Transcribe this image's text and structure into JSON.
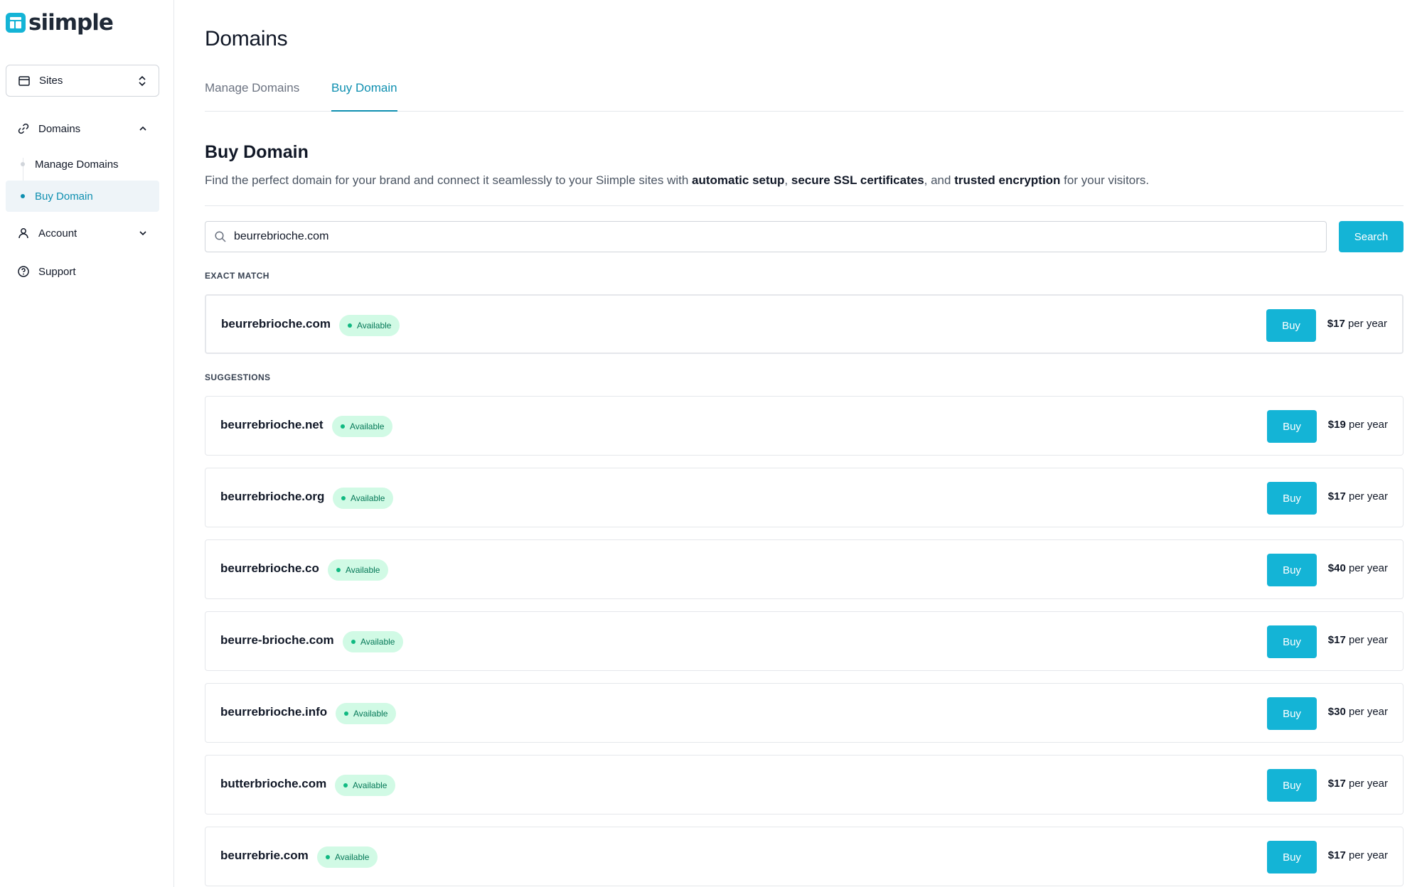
{
  "brand": {
    "name": "siimple",
    "color": "#14b4d6"
  },
  "sidebar": {
    "site_select": {
      "label": "Sites"
    },
    "items": [
      {
        "label": "Domains",
        "icon": "link-icon",
        "expanded": true
      },
      {
        "label": "Account",
        "icon": "user-icon",
        "expanded": false
      },
      {
        "label": "Support",
        "icon": "help-circle-icon"
      }
    ],
    "domains_sub": [
      {
        "label": "Manage Domains",
        "active": false
      },
      {
        "label": "Buy Domain",
        "active": true
      }
    ]
  },
  "page": {
    "title": "Domains",
    "tabs": [
      {
        "label": "Manage Domains",
        "active": false
      },
      {
        "label": "Buy Domain",
        "active": true
      }
    ]
  },
  "buy": {
    "title": "Buy Domain",
    "desc_1": "Find the perfect domain for your brand and connect it seamlessly to your Siimple sites with ",
    "desc_b1": "automatic setup",
    "desc_2": ", ",
    "desc_b2": "secure SSL certificates",
    "desc_3": ", and ",
    "desc_b3": "trusted encryption",
    "desc_4": " for your visitors.",
    "search_value": "beurrebrioche.com",
    "search_button": "Search",
    "exact_label": "EXACT MATCH",
    "suggestions_label": "SUGGESTIONS",
    "buy_label": "Buy",
    "exact": {
      "domain": "beurrebrioche.com",
      "status": "Available",
      "price": "$17",
      "period": "per year"
    },
    "suggestions": [
      {
        "domain": "beurrebrioche.net",
        "status": "Available",
        "price": "$19",
        "period": "per year"
      },
      {
        "domain": "beurrebrioche.org",
        "status": "Available",
        "price": "$17",
        "period": "per year"
      },
      {
        "domain": "beurrebrioche.co",
        "status": "Available",
        "price": "$40",
        "period": "per year"
      },
      {
        "domain": "beurre-brioche.com",
        "status": "Available",
        "price": "$17",
        "period": "per year"
      },
      {
        "domain": "beurrebrioche.info",
        "status": "Available",
        "price": "$30",
        "period": "per year"
      },
      {
        "domain": "butterbrioche.com",
        "status": "Available",
        "price": "$17",
        "period": "per year"
      },
      {
        "domain": "beurrebrie.com",
        "status": "Available",
        "price": "$17",
        "period": "per year"
      }
    ]
  }
}
